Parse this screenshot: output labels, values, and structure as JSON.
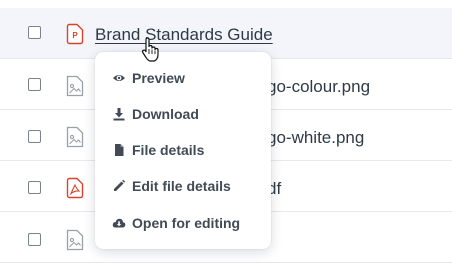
{
  "files": [
    {
      "name": "Brand Standards Guide",
      "icon": "pdf-file-icon",
      "hovered": true
    },
    {
      "name": "go-colour.png",
      "icon": "image-file-icon",
      "hovered": false
    },
    {
      "name": "go-white.png",
      "icon": "image-file-icon",
      "hovered": false
    },
    {
      "name": "df",
      "icon": "pdf-file-icon",
      "hovered": false
    },
    {
      "name": "",
      "icon": "image-file-icon",
      "hovered": false
    }
  ],
  "context_menu": {
    "items": [
      {
        "label": "Preview",
        "icon": "eye-icon"
      },
      {
        "label": "Download",
        "icon": "download-icon"
      },
      {
        "label": "File details",
        "icon": "file-icon"
      },
      {
        "label": "Edit file details",
        "icon": "pencil-icon"
      },
      {
        "label": "Open for editing",
        "icon": "cloud-download-icon"
      }
    ]
  },
  "colors": {
    "pdf_accent": "#d9432b",
    "row_hover": "#f3f5fb",
    "text": "#2f3a45"
  }
}
